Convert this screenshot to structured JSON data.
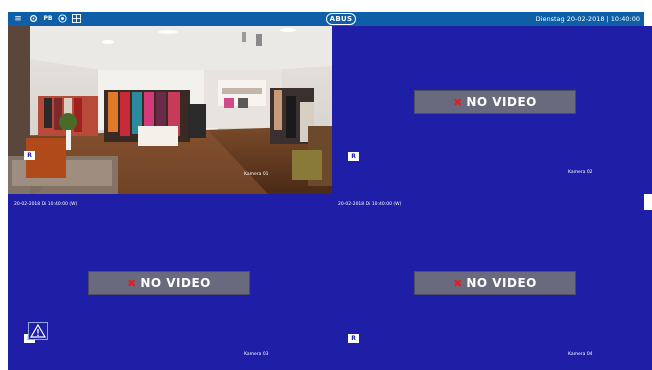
{
  "topbar": {
    "icons": [
      "menu-icon",
      "settings-icon",
      "playback-icon",
      "record-icon",
      "layout-icon"
    ],
    "playback_label": "PB",
    "logo": "ABUS",
    "datetime": "Dienstag 20-02-2018 | 10:40:00"
  },
  "cameras": [
    {
      "name": "Kamera 01",
      "rec_badge": "R",
      "state": "live"
    },
    {
      "name": "Kamera 02",
      "rec_badge": "R",
      "no_video": "NO VIDEO"
    },
    {
      "name": "Kamera 03",
      "rec_badge": "R",
      "no_video": "NO VIDEO"
    },
    {
      "name": "Kamera 04",
      "rec_badge": "R",
      "no_video": "NO VIDEO"
    }
  ],
  "osd_timestamps": [
    "20-02-2018 Di 10:40:00 (W)",
    "20-02-2018 Di 10:40:00 (W)"
  ],
  "alarm": {
    "icon": "warning-icon"
  },
  "colors": {
    "topbar": "#0f5fa8",
    "cell_bg": "#1e1ea6",
    "no_video_bg": "#6a6a7e",
    "no_video_x": "#e02020"
  }
}
